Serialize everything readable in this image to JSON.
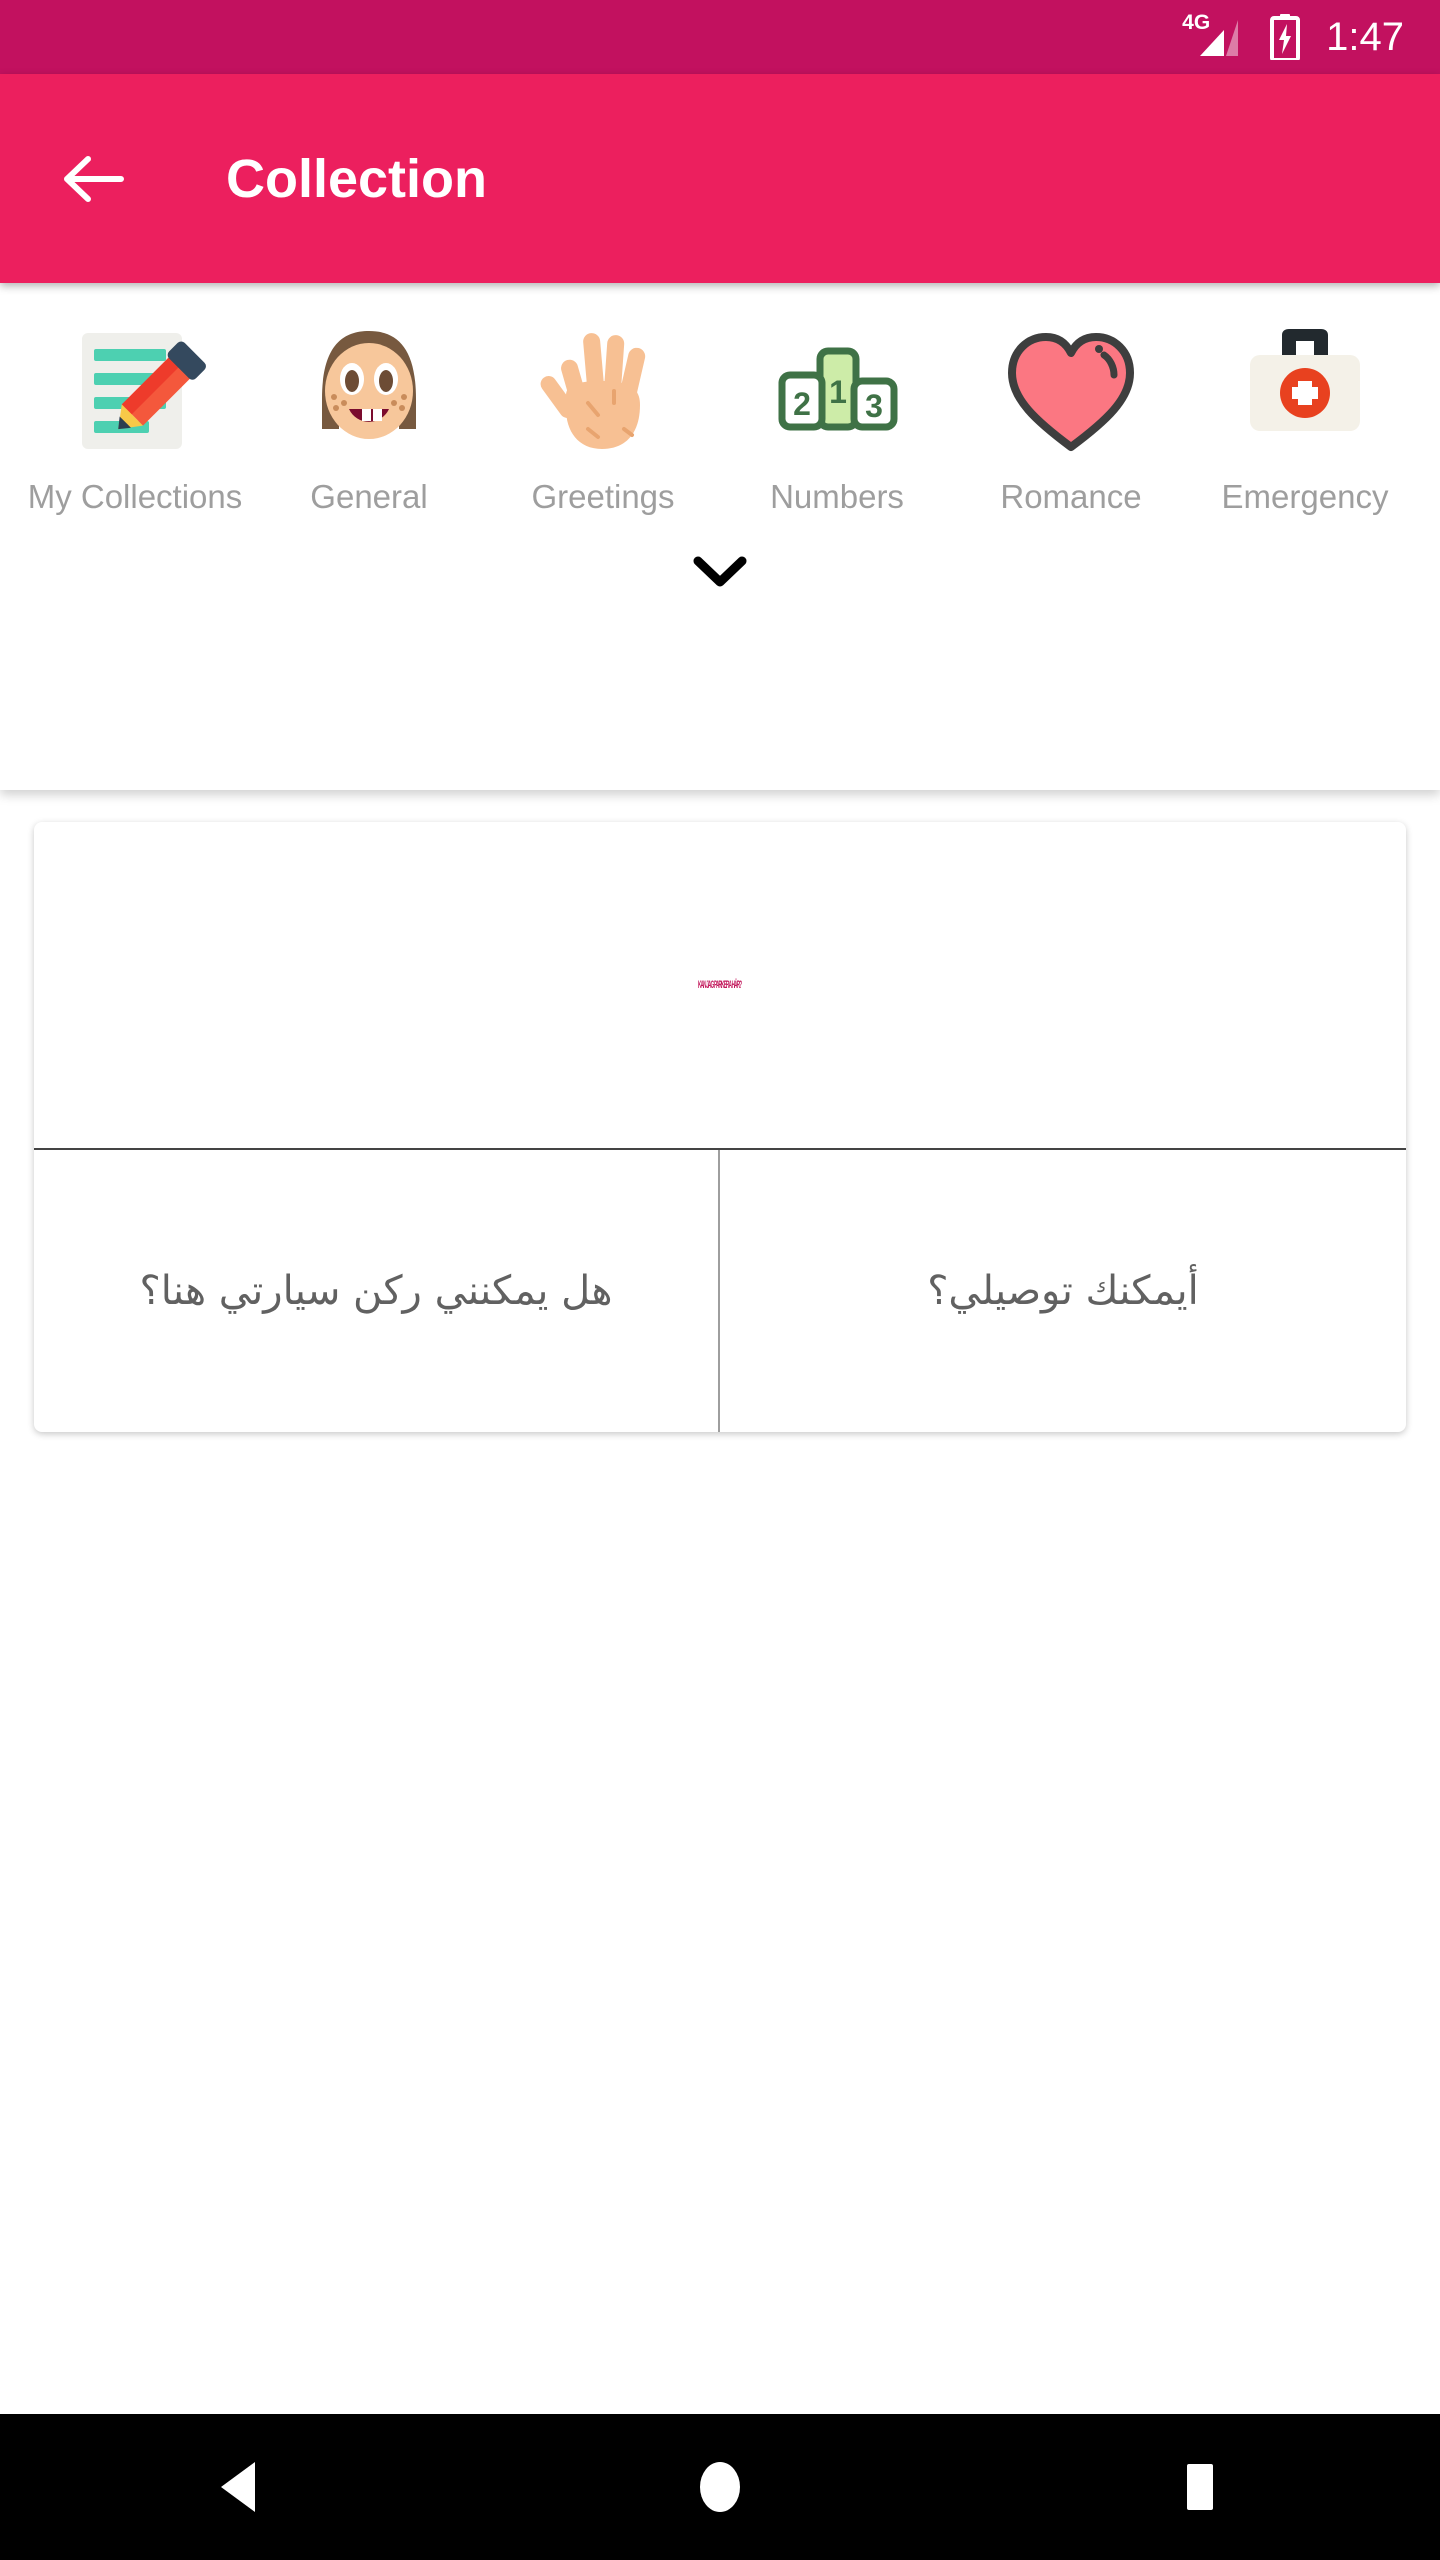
{
  "status_bar": {
    "network_label": "4G",
    "time": "1:47",
    "battery_state": "charging",
    "background_color": "#C2115F"
  },
  "app_bar": {
    "title": "Collection",
    "back_icon": "arrow-left-icon",
    "background_color": "#EC1F5E"
  },
  "categories": {
    "expand_icon": "chevron-down-icon",
    "items": [
      {
        "label": "My Collections",
        "icon": "memo-pencil-icon"
      },
      {
        "label": "General",
        "icon": "girl-face-icon"
      },
      {
        "label": "Greetings",
        "icon": "raised-hand-icon"
      },
      {
        "label": "Numbers",
        "icon": "podium-icon"
      },
      {
        "label": "Romance",
        "icon": "heart-icon"
      },
      {
        "label": "Emergency",
        "icon": "first-aid-kit-icon"
      }
    ]
  },
  "phrase_card": {
    "header_text": "KAN JAG PARKERA HÄR?",
    "header_text_color": "#C2185B",
    "cells": [
      {
        "text": "هل يمكنني ركن سيارتي هنا؟"
      },
      {
        "text": "أيمكنك توصيلي؟"
      }
    ]
  },
  "nav_bar": {
    "back_label": "back-triangle",
    "home_label": "home-circle",
    "recents_label": "recents-square",
    "background_color": "#000000"
  }
}
